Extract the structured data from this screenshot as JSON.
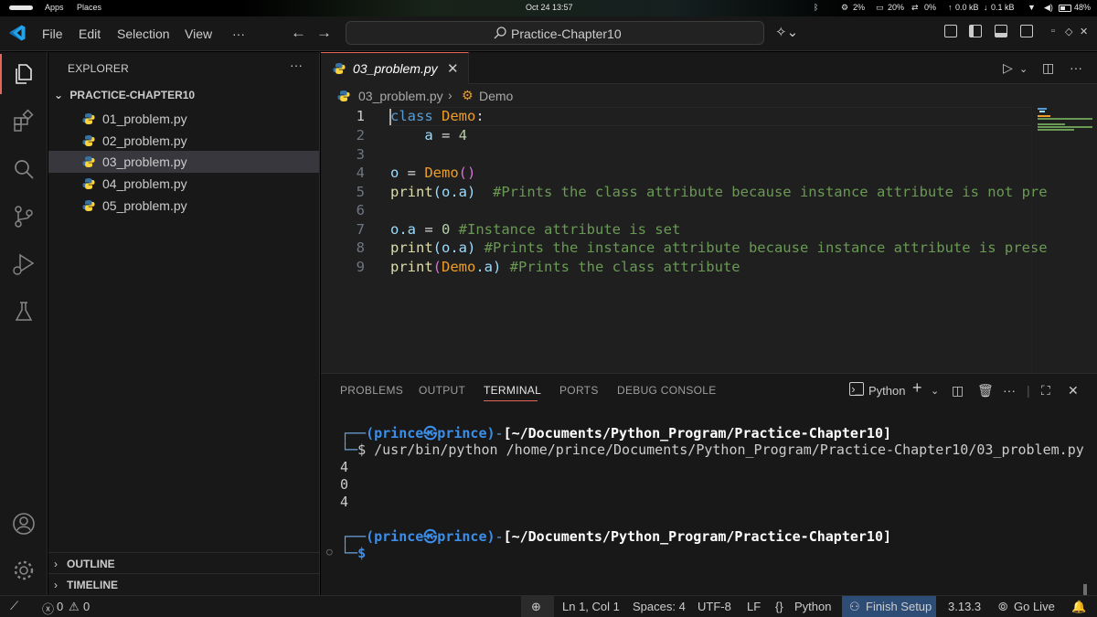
{
  "os_bar": {
    "apps": "Apps",
    "places": "Places",
    "datetime": "Oct 24  13:57",
    "cpu": "2%",
    "mem": "20%",
    "swap": "0%",
    "net_up": "0.0 kB",
    "net_down": "0.1 kB",
    "battery": "48%"
  },
  "titlebar": {
    "menu": [
      "File",
      "Edit",
      "Selection",
      "View",
      "···"
    ],
    "search_label": "Practice-Chapter10"
  },
  "explorer": {
    "title": "EXPLORER",
    "more": "···",
    "folder": "PRACTICE-CHAPTER10",
    "files": [
      "01_problem.py",
      "02_problem.py",
      "03_problem.py",
      "04_problem.py",
      "05_problem.py"
    ],
    "outline": "OUTLINE",
    "timeline": "TIMELINE"
  },
  "editor": {
    "tab_name": "03_problem.py",
    "breadcrumb_file": "03_problem.py",
    "breadcrumb_symbol": "Demo",
    "line_numbers": [
      "1",
      "2",
      "3",
      "4",
      "5",
      "6",
      "7",
      "8",
      "9"
    ],
    "code": {
      "l1": {
        "kw": "class",
        "name": "Demo",
        "colon": ":"
      },
      "l2": {
        "indent": "    ",
        "var": "a",
        "op": " = ",
        "num": "4"
      },
      "l4": {
        "var": "o",
        "op": " = ",
        "cls": "Demo",
        "paren": "()"
      },
      "l5": {
        "fn": "print",
        "arg": "(o.a)",
        "comment": "  #Prints the class attribute because instance attribute is not pre"
      },
      "l7": {
        "var": "o.a",
        "op": " = ",
        "num": "0",
        "comment": " #Instance attribute is set"
      },
      "l8": {
        "fn": "print",
        "arg": "(o.a)",
        "comment": " #Prints the instance attribute because instance attribute is prese"
      },
      "l9": {
        "fn": "print",
        "open": "(",
        "cls": "Demo",
        "arg": ".a)",
        "comment": " #Prints the class attribute"
      }
    }
  },
  "panel": {
    "tabs": [
      "PROBLEMS",
      "OUTPUT",
      "TERMINAL",
      "PORTS",
      "DEBUG CONSOLE"
    ],
    "active_tab": "TERMINAL",
    "terminal_name": "Python",
    "more": "···",
    "terminal": {
      "prompt_user": "(prince㉿prince)",
      "prompt_dir": "[~/Documents/Python_Program/Practice-Chapter10]",
      "command": "$ /usr/bin/python /home/prince/Documents/Python_Program/Practice-Chapter10/03_problem.py",
      "outputs": [
        "4",
        "0",
        "4"
      ],
      "prompt_user2": "(prince㉿prince)",
      "prompt_dir2": "[~/Documents/Python_Program/Practice-Chapter10]",
      "prompt2": "$"
    }
  },
  "statusbar": {
    "errors": "0",
    "warnings": "0",
    "position": "Ln 1, Col 1",
    "spaces": "Spaces: 4",
    "encoding": "UTF-8",
    "eol": "LF",
    "language": "Python",
    "finish_setup": "Finish Setup",
    "version": "3.13.3",
    "golive": "Go Live"
  },
  "colors": {
    "accent": "#e4665b",
    "vscode_blue": "#23a3ea",
    "python_blue": "#3572a5",
    "python_yellow": "#ffd43b"
  }
}
